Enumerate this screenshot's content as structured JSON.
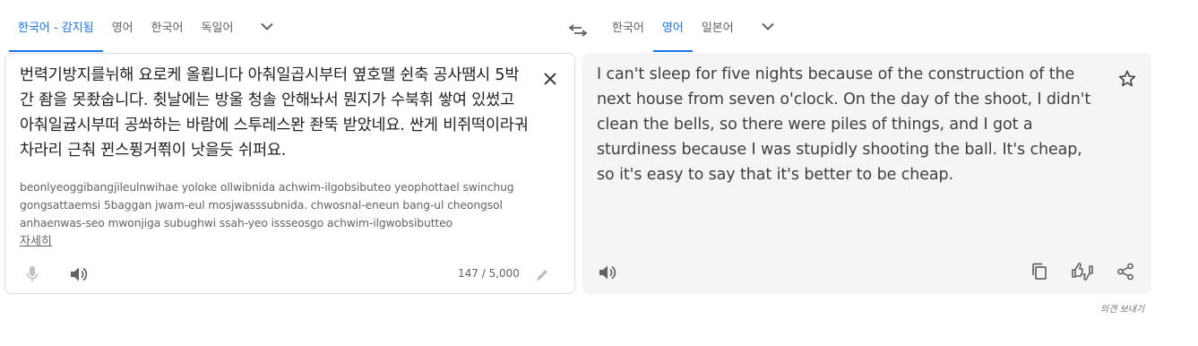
{
  "source_tabs": [
    {
      "label": "한국어 - 감지됨",
      "active": true
    },
    {
      "label": "영어",
      "active": false
    },
    {
      "label": "한국어",
      "active": false
    },
    {
      "label": "독일어",
      "active": false
    }
  ],
  "target_tabs": [
    {
      "label": "한국어",
      "active": false
    },
    {
      "label": "영어",
      "active": true
    },
    {
      "label": "일본어",
      "active": false
    }
  ],
  "source": {
    "text": "번력기방지를뉘해 요로케 올룁니다 아춰일곱시부터 옆호땔 쉰축 공사땜시 5박간 좜을 못좠숩니다. 췻날에는 방울 청솔 안해놔서 뭔지가 수북휘 쌓여 있썼고 아춰일귭시부떠 공쏴하는 바람에 스투레스뫈 좐뚝 받았네요. 싼게 비쥐떡이라궈 차라리 근춰 뀐스퓡거쬒이 낫을듯 쉬퍼요.",
    "transliteration": "beonlyeoggibangjileulnwihae yoloke ollwibnida achwim-ilgobsibuteo yeophottael swinchug gongsattaemsi 5baggan jwam-eul mosjwasssubnida. chwosnal-eneun bang-ul cheongsol anhaenwas-seo mwonjiga subughwi ssah-yeo issseosgo achwim-ilgwobsibutteo",
    "more_link": "자세히",
    "char_count": "147 / 5,000"
  },
  "target": {
    "text": "I can't sleep for five nights because of the construction of the next house from seven o'clock. On the day of the shoot, I didn't clean the bells, so there were piles of things, and I got a sturdiness because I was stupidly shooting the ball. It's cheap, so it's easy to say that it's better to be cheap."
  },
  "feedback_label": "의견 보내기",
  "icons": [
    "chevron-down-icon",
    "swap-icon",
    "close-icon",
    "mic-icon",
    "speaker-icon",
    "pencil-icon",
    "star-icon",
    "copy-icon",
    "rate-icon",
    "share-icon"
  ],
  "colors": {
    "accent": "#1a73e8",
    "target_bg": "#f5f5f5",
    "border": "#dadce0",
    "text": "#202124",
    "muted": "#5f6368"
  }
}
